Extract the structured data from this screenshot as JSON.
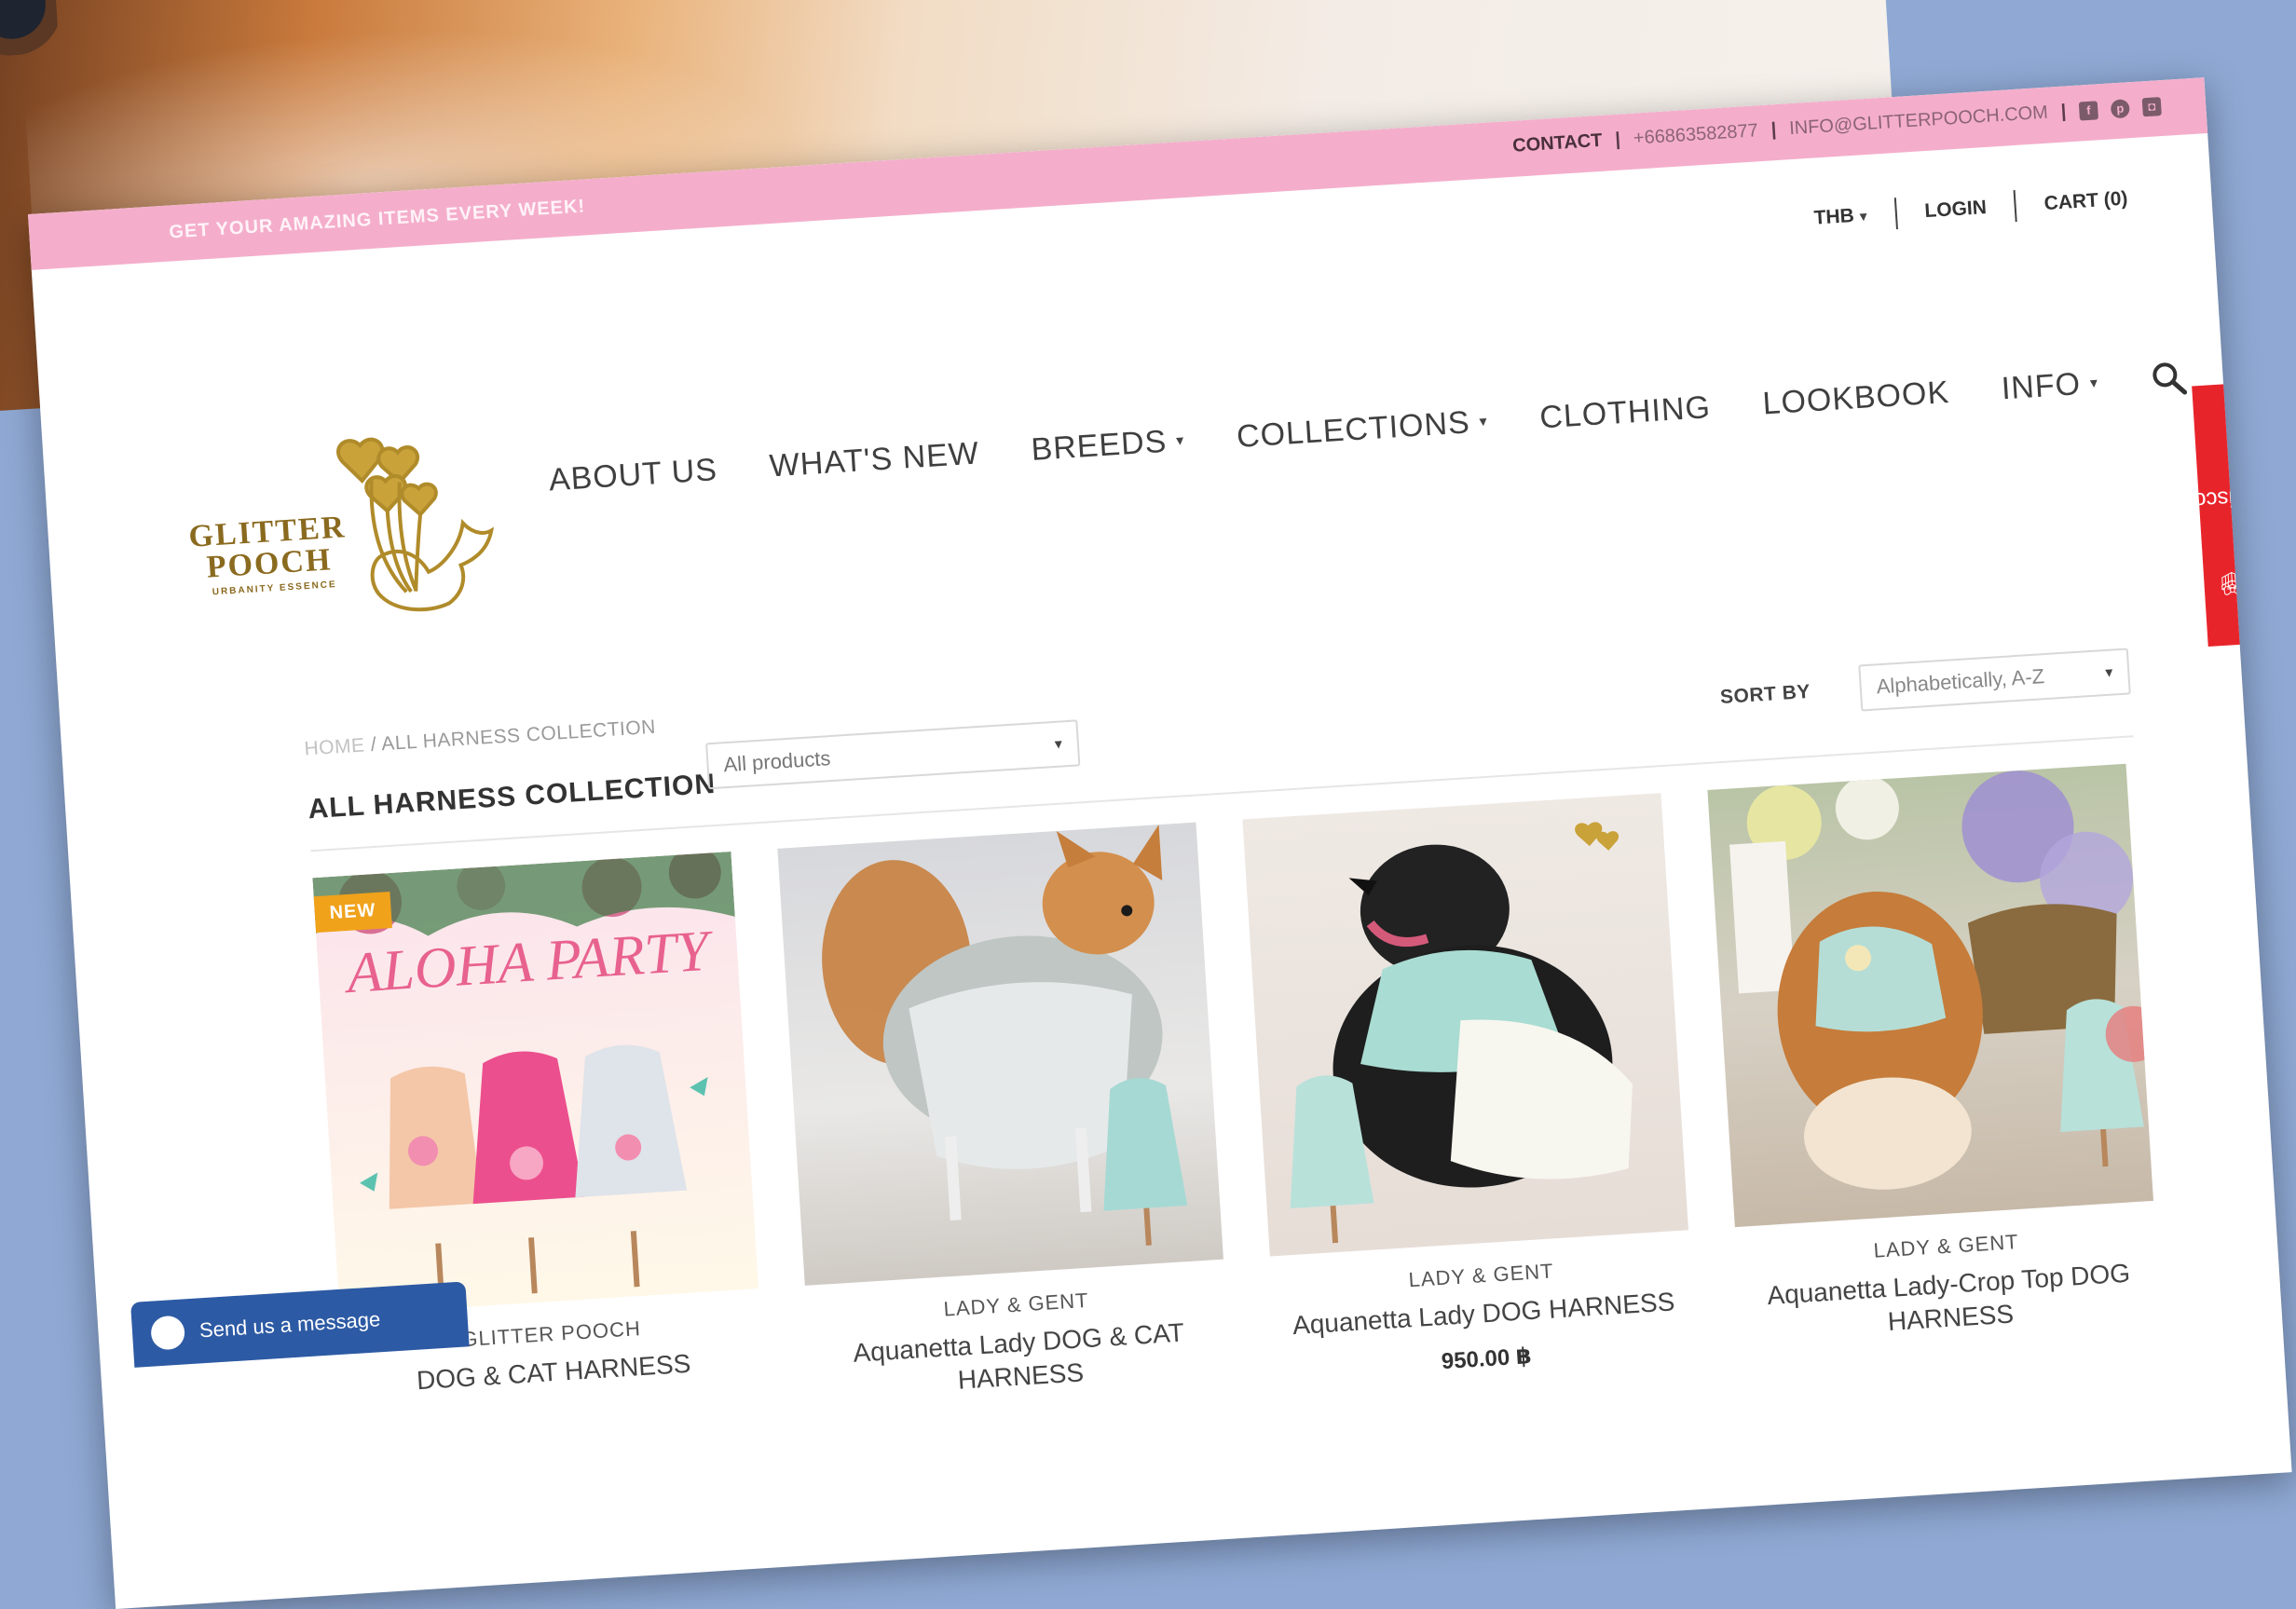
{
  "topbar": {
    "promo": "GET YOUR AMAZING ITEMS EVERY WEEK!",
    "contact": "CONTACT",
    "phone": "+66863582877",
    "email": "INFO@GLITTERPOOCH.COM",
    "social": [
      "facebook-icon",
      "pinterest-icon",
      "instagram-icon"
    ]
  },
  "util": {
    "currency": "THB",
    "login": "LOGIN",
    "cart": "CART (0)"
  },
  "logo": {
    "line1": "GLITTER",
    "line2": "POOCH",
    "tagline": "URBANITY ESSENCE"
  },
  "nav": {
    "items": [
      {
        "label": "ABOUT US",
        "dropdown": false
      },
      {
        "label": "WHAT'S NEW",
        "dropdown": false
      },
      {
        "label": "BREEDS",
        "dropdown": true
      },
      {
        "label": "COLLECTIONS",
        "dropdown": true
      },
      {
        "label": "CLOTHING",
        "dropdown": false
      },
      {
        "label": "LOOKBOOK",
        "dropdown": false
      },
      {
        "label": "INFO",
        "dropdown": true
      }
    ]
  },
  "discount_tab": "Get Discount",
  "breadcrumb": {
    "home": "HOME",
    "sep": "/",
    "current": "ALL HARNESS COLLECTION"
  },
  "page_title": "ALL HARNESS COLLECTION",
  "filter": {
    "selected": "All products"
  },
  "sort": {
    "label": "SORT BY",
    "selected": "Alphabetically, A-Z"
  },
  "products": [
    {
      "badge": "NEW",
      "brand": "GLITTER POOCH",
      "name": "DOG & CAT HARNESS",
      "price": "",
      "image_text": "ALOHA PARTY"
    },
    {
      "badge": "",
      "brand": "LADY & GENT",
      "name": "Aquanetta Lady DOG & CAT HARNESS",
      "price": ""
    },
    {
      "badge": "",
      "brand": "LADY & GENT",
      "name": "Aquanetta Lady DOG HARNESS",
      "price": "950.00 ฿"
    },
    {
      "badge": "",
      "brand": "LADY & GENT",
      "name": "Aquanetta Lady-Crop Top DOG HARNESS",
      "price": ""
    }
  ],
  "chat": {
    "label": "Send us a message"
  },
  "colors": {
    "topbar": "#f4aecb",
    "discount": "#e8242b",
    "badge": "#f0a21b",
    "gold": "#a8841f",
    "chat": "#2d5aa4"
  }
}
